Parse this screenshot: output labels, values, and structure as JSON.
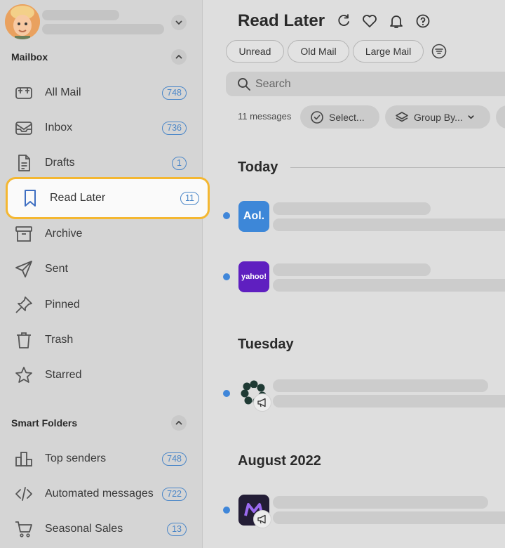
{
  "sidebar": {
    "mailbox_title": "Mailbox",
    "smart_folders_title": "Smart Folders",
    "items": [
      {
        "label": "All Mail",
        "count": "748",
        "icon": "all-mail-icon"
      },
      {
        "label": "Inbox",
        "count": "736",
        "icon": "inbox-icon"
      },
      {
        "label": "Drafts",
        "count": "1",
        "icon": "drafts-icon"
      },
      {
        "label": "Read Later",
        "count": "11",
        "icon": "bookmark-icon",
        "active": true
      },
      {
        "label": "Archive",
        "count": "",
        "icon": "archive-icon"
      },
      {
        "label": "Sent",
        "count": "",
        "icon": "sent-icon"
      },
      {
        "label": "Pinned",
        "count": "",
        "icon": "pin-icon"
      },
      {
        "label": "Trash",
        "count": "",
        "icon": "trash-icon"
      },
      {
        "label": "Starred",
        "count": "",
        "icon": "star-icon"
      }
    ],
    "smart_items": [
      {
        "label": "Top senders",
        "count": "748",
        "icon": "top-senders-icon"
      },
      {
        "label": "Automated messages",
        "count": "722",
        "icon": "code-icon"
      },
      {
        "label": "Seasonal Sales",
        "count": "13",
        "icon": "cart-icon"
      }
    ]
  },
  "main": {
    "title": "Read Later",
    "filters": [
      "Unread",
      "Old Mail",
      "Large Mail"
    ],
    "search_placeholder": "Search",
    "message_count": "11 messages",
    "select_label": "Select...",
    "group_by_label": "Group By...",
    "groups": [
      "Today",
      "Tuesday",
      "August 2022"
    ],
    "logos": {
      "aol": "Aol.",
      "yahoo": "yahoo!"
    }
  },
  "colors": {
    "accent": "#3f86d9",
    "highlight_border": "#f4b731",
    "aol_blue": "#3d87d8",
    "yahoo_purple": "#5f1fc0"
  }
}
